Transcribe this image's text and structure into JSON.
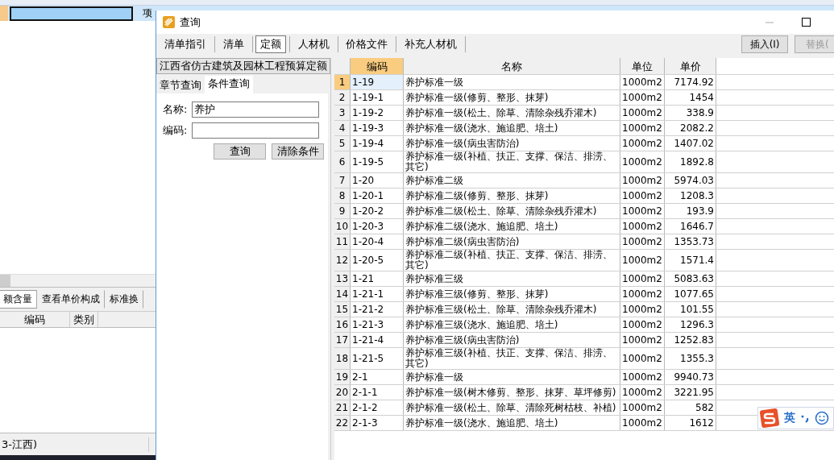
{
  "background_app": {
    "row": {
      "type_cell": "项",
      "selected": true
    },
    "tabs": [
      {
        "label": "额含量",
        "selected": true
      },
      {
        "label": "查看单价构成",
        "selected": false
      },
      {
        "label": "标准换",
        "selected": false
      }
    ],
    "columns": [
      "编码",
      "类别"
    ],
    "status_bar": [
      "3-江西)"
    ]
  },
  "dialog": {
    "title": "查询",
    "tabs": [
      {
        "label": "清单指引",
        "selected": false
      },
      {
        "label": "清单",
        "selected": false
      },
      {
        "label": "定额",
        "selected": true
      },
      {
        "label": "人材机",
        "selected": false
      },
      {
        "label": "价格文件",
        "selected": false
      },
      {
        "label": "补充人材机",
        "selected": false
      }
    ],
    "actions": [
      {
        "label": "插入(I)",
        "disabled": false
      },
      {
        "label": "替换(",
        "disabled": true
      }
    ],
    "library": "江西省仿古建筑及园林工程预算定额",
    "search_tabs": [
      {
        "label": "章节查询",
        "selected": false
      },
      {
        "label": "条件查询",
        "selected": true
      }
    ],
    "fields": [
      {
        "label": "名称:",
        "value": "养护"
      },
      {
        "label": "编码:"
      }
    ],
    "buttons": [
      "查询",
      "清除条件"
    ],
    "table": {
      "columns": [
        {
          "label": "编码",
          "selected": true
        },
        {
          "label": "名称",
          "selected": false
        },
        {
          "label": "单位",
          "selected": false
        },
        {
          "label": "单价",
          "selected": false
        }
      ],
      "rows": [
        {
          "no": "1",
          "code": "1-19",
          "name": "养护标准一级",
          "unit": "1000m2",
          "price": "7174.92",
          "selected": true
        },
        {
          "no": "2",
          "code": "1-19-1",
          "name": "养护标准一级(修剪、整形、抹芽)",
          "unit": "1000m2",
          "price": "1454",
          "selected": false
        },
        {
          "no": "3",
          "code": "1-19-2",
          "name": "养护标准一级(松土、除草、清除杂残乔灌木)",
          "unit": "1000m2",
          "price": "338.9",
          "selected": false
        },
        {
          "no": "4",
          "code": "1-19-3",
          "name": "养护标准一级(浇水、施追肥、培土)",
          "unit": "1000m2",
          "price": "2082.2",
          "selected": false
        },
        {
          "no": "5",
          "code": "1-19-4",
          "name": "养护标准一级(病虫害防治)",
          "unit": "1000m2",
          "price": "1407.02",
          "selected": false
        },
        {
          "no": "6",
          "code": "1-19-5",
          "name": "养护标准一级(补植、扶正、支撑、保洁、排涝、其它)",
          "unit": "1000m2",
          "price": "1892.8",
          "selected": false
        },
        {
          "no": "7",
          "code": "1-20",
          "name": "养护标准二级",
          "unit": "1000m2",
          "price": "5974.03",
          "selected": false
        },
        {
          "no": "8",
          "code": "1-20-1",
          "name": "养护标准二级(修剪、整形、抹芽)",
          "unit": "1000m2",
          "price": "1208.3",
          "selected": false
        },
        {
          "no": "9",
          "code": "1-20-2",
          "name": "养护标准二级(松土、除草、清除杂残乔灌木)",
          "unit": "1000m2",
          "price": "193.9",
          "selected": false
        },
        {
          "no": "10",
          "code": "1-20-3",
          "name": "养护标准二级(浇水、施追肥、培土)",
          "unit": "1000m2",
          "price": "1646.7",
          "selected": false
        },
        {
          "no": "11",
          "code": "1-20-4",
          "name": "养护标准二级(病虫害防治)",
          "unit": "1000m2",
          "price": "1353.73",
          "selected": false
        },
        {
          "no": "12",
          "code": "1-20-5",
          "name": "养护标准二级(补植、扶正、支撑、保洁、排涝、其它)",
          "unit": "1000m2",
          "price": "1571.4",
          "selected": false
        },
        {
          "no": "13",
          "code": "1-21",
          "name": "养护标准三级",
          "unit": "1000m2",
          "price": "5083.63",
          "selected": false
        },
        {
          "no": "14",
          "code": "1-21-1",
          "name": "养护标准三级(修剪、整形、抹芽)",
          "unit": "1000m2",
          "price": "1077.65",
          "selected": false
        },
        {
          "no": "15",
          "code": "1-21-2",
          "name": "养护标准三级(松土、除草、清除杂残乔灌木)",
          "unit": "1000m2",
          "price": "101.55",
          "selected": false
        },
        {
          "no": "16",
          "code": "1-21-3",
          "name": "养护标准三级(浇水、施追肥、培土)",
          "unit": "1000m2",
          "price": "1296.3",
          "selected": false
        },
        {
          "no": "17",
          "code": "1-21-4",
          "name": "养护标准三级(病虫害防治)",
          "unit": "1000m2",
          "price": "1252.83",
          "selected": false
        },
        {
          "no": "18",
          "code": "1-21-5",
          "name": "养护标准三级(补植、扶正、支撑、保洁、排涝、其它)",
          "unit": "1000m2",
          "price": "1355.3",
          "selected": false
        },
        {
          "no": "19",
          "code": "2-1",
          "name": "养护标准一级",
          "unit": "1000m2",
          "price": "9940.73",
          "selected": false
        },
        {
          "no": "20",
          "code": "2-1-1",
          "name": "养护标准一级(树木修剪、整形、抹芽、草坪修剪)",
          "unit": "1000m2",
          "price": "3221.95",
          "selected": false
        },
        {
          "no": "21",
          "code": "2-1-2",
          "name": "养护标准一级(松土、除草、清除死树枯枝、补植)",
          "unit": "1000m2",
          "price": "582",
          "selected": false
        },
        {
          "no": "22",
          "code": "2-1-3",
          "name": "养护标准一级(浇水、施追肥、培土)",
          "unit": "1000m2",
          "price": "1612",
          "selected": false
        }
      ]
    }
  },
  "ime": {
    "mode": "英"
  }
}
